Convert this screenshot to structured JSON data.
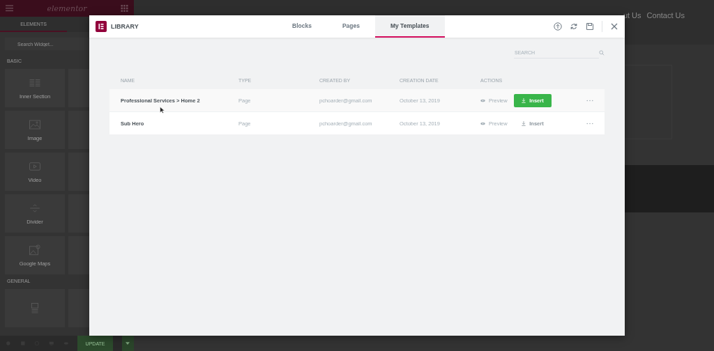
{
  "editor_sidebar": {
    "logo": "elementor",
    "tabs": [
      {
        "label": "ELEMENTS",
        "selected": true
      }
    ],
    "search": {
      "placeholder": "Search Widget..."
    },
    "sections": [
      {
        "title": "BASIC",
        "widgets": [
          {
            "label": "Inner Section",
            "kind": "columns"
          },
          {
            "label": "Image",
            "kind": "image"
          },
          {
            "label": "Video",
            "kind": "video"
          },
          {
            "label": "Divider",
            "kind": "divider"
          },
          {
            "label": "Google Maps",
            "kind": "map"
          }
        ]
      },
      {
        "title": "GENERAL",
        "widgets": [
          {
            "kind": "image-box"
          }
        ]
      }
    ],
    "footer": {
      "update_button": "UPDATE"
    }
  },
  "site_preview": {
    "nav": [
      "ut Us",
      "Contact Us"
    ]
  },
  "library_modal": {
    "title": "LIBRARY",
    "tabs": [
      {
        "label": "Blocks",
        "selected": false
      },
      {
        "label": "Pages",
        "selected": false
      },
      {
        "label": "My Templates",
        "selected": true
      }
    ],
    "search": {
      "placeholder": "SEARCH"
    },
    "table": {
      "columns": [
        "NAME",
        "TYPE",
        "CREATED BY",
        "CREATION DATE",
        "ACTIONS"
      ],
      "rows": [
        {
          "name": "Professional Services > Home 2",
          "type": "Page",
          "created_by": "pchoarder@gmail.com",
          "creation_date": "October 13, 2019",
          "preview": "Preview",
          "insert": "Insert",
          "highlighted": true
        },
        {
          "name": "Sub Hero",
          "type": "Page",
          "created_by": "pchoarder@gmail.com",
          "creation_date": "October 13, 2019",
          "preview": "Preview",
          "insert": "Insert",
          "highlighted": false
        }
      ]
    }
  }
}
